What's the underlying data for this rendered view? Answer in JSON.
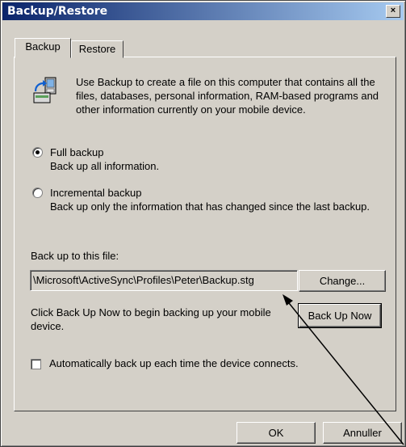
{
  "window": {
    "title": "Backup/Restore",
    "close_glyph": "×"
  },
  "tabs": [
    {
      "label": "Backup",
      "active": true
    },
    {
      "label": "Restore",
      "active": false
    }
  ],
  "backup": {
    "description": "Use Backup to create a file on this computer that contains all the files, databases, personal information, RAM-based programs and other information currently on your mobile device.",
    "icon": "activesync-backup-icon",
    "options": [
      {
        "label": "Full backup",
        "sub": "Back up all information.",
        "selected": true
      },
      {
        "label": "Incremental backup",
        "sub": "Back up only the information that has changed since the last backup.",
        "selected": false
      }
    ],
    "file_label": "Back up to this file:",
    "file_value": "\\Microsoft\\ActiveSync\\Profiles\\Peter\\Backup.stg",
    "change_label": "Change...",
    "hint": "Click Back Up Now to begin backing up your mobile device.",
    "backup_now_label": "Back Up Now",
    "auto_label": "Automatically back up each time the device connects.",
    "auto_checked": false
  },
  "footer": {
    "ok_label": "OK",
    "cancel_label": "Annuller"
  }
}
